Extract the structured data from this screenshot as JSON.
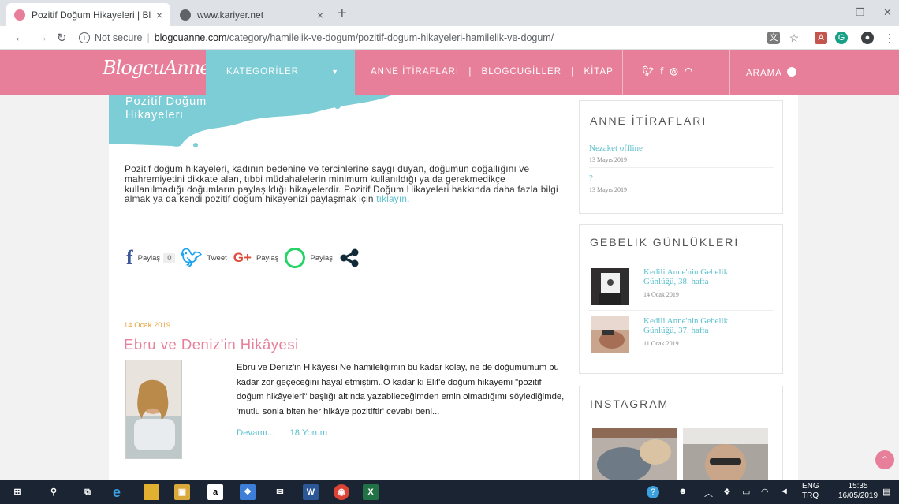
{
  "browser": {
    "tabs": [
      {
        "title": "Pozitif Doğum Hikayeleri | Blogcu",
        "active": true
      },
      {
        "title": "www.kariyer.net",
        "active": false
      }
    ],
    "new_tab": "+",
    "close": "×",
    "security": "Not secure",
    "url_host": "blogcuanne.com",
    "url_path": "/category/hamilelik-ve-dogum/pozitif-dogum-hikayeleri-hamilelik-ve-dogum/"
  },
  "header": {
    "logo": "BlogcuAnne",
    "category_menu": "KATEGORİLER",
    "nav": [
      "ANNE İTİRAFLARI",
      "BLOGCUGİLLER",
      "KİTAP"
    ],
    "nav_sep": "|",
    "social": [
      "twitter-icon",
      "facebook-icon",
      "instagram-icon",
      "rss-icon"
    ],
    "search": "ARAMA"
  },
  "category": {
    "title_line1": "Pozitif Doğum",
    "title_line2": "Hikayeleri",
    "description": "Pozitif doğum hikayeleri, kadının bedenine ve tercihlerine saygı duyan, doğumun doğallığını ve mahremiyetini dikkate alan, tıbbi müdahalelerin minimum kullanıldığı ya da gerekmedikçe kullanılmadığı doğumların paylaşıldığı hikayelerdir. Pozitif Doğum Hikayeleri hakkında daha fazla bilgi almak ya da kendi pozitif doğum hikayenizi paylaşmak için ",
    "description_link": "tıklayın."
  },
  "share": {
    "facebook_label": "Paylaş",
    "facebook_count": "0",
    "twitter_label": "Tweet",
    "gplus_label": "Paylaş",
    "whatsapp_label": "Paylaş"
  },
  "post": {
    "date": "14 Ocak 2019",
    "title": "Ebru ve Deniz'in Hikâyesi",
    "excerpt": "Ebru ve Deniz'in Hikâyesi Ne hamileliğimin bu kadar kolay, ne de doğumumum bu kadar zor geçeceğini hayal etmiştim..O kadar ki Elif'e doğum hikayemi \"pozitif doğum hikâyeleri\" başlığı altında yazabileceğimden emin olmadığımı söylediğimde, 'mutlu sonla biten her hikâye pozitiftir' cevabı beni...",
    "more": "Devamı...",
    "comments": "18 Yorum"
  },
  "sidebar": {
    "anne_itiraflari": {
      "title": "ANNE İTİRAFLARI",
      "items": [
        {
          "title": "Nezaket offline",
          "date": "13 Mayıs 2019"
        },
        {
          "title": "?",
          "date": "13 Mayıs 2019"
        }
      ]
    },
    "gebelik": {
      "title": "GEBELİK GÜNLÜKLERİ",
      "items": [
        {
          "title": "Kedili Anne'nin Gebelik Günlüğü, 38. hafta",
          "date": "14 Ocak 2019"
        },
        {
          "title": "Kedili Anne'nin Gebelik Günlüğü, 37. hafta",
          "date": "11 Ocak 2019"
        }
      ]
    },
    "instagram": {
      "title": "INSTAGRAM"
    }
  },
  "taskbar": {
    "lang1": "ENG",
    "lang2": "TRQ",
    "time": "15:35",
    "date": "16/05/2019"
  }
}
